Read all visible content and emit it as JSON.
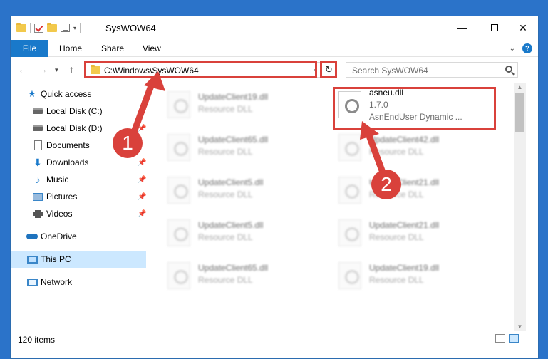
{
  "window": {
    "title": "SysWOW64"
  },
  "ribbon": {
    "tabs": [
      "File",
      "Home",
      "Share",
      "View"
    ]
  },
  "address": {
    "path": "C:\\Windows\\SysWOW64"
  },
  "search": {
    "placeholder": "Search SysWOW64"
  },
  "sidebar": {
    "items": [
      {
        "label": "Quick access",
        "icon": "star-icon"
      },
      {
        "label": "Local Disk (C:)",
        "icon": "drive-icon"
      },
      {
        "label": "Local Disk (D:)",
        "icon": "drive-icon"
      },
      {
        "label": "Documents",
        "icon": "documents-icon"
      },
      {
        "label": "Downloads",
        "icon": "downloads-icon"
      },
      {
        "label": "Music",
        "icon": "music-icon"
      },
      {
        "label": "Pictures",
        "icon": "pictures-icon"
      },
      {
        "label": "Videos",
        "icon": "videos-icon"
      },
      {
        "label": "OneDrive",
        "icon": "cloud-icon"
      },
      {
        "label": "This PC",
        "icon": "computer-icon"
      },
      {
        "label": "Network",
        "icon": "network-icon"
      }
    ]
  },
  "files": {
    "left": [
      {
        "name": "UpdateClient19.dll",
        "type": "Resource DLL"
      },
      {
        "name": "UpdateClient65.dll",
        "type": "Resource DLL"
      },
      {
        "name": "UpdateClient5.dll",
        "type": "Resource DLL"
      },
      {
        "name": "UpdateClient5.dll",
        "type": "Resource DLL"
      },
      {
        "name": "UpdateClient65.dll",
        "type": "Resource DLL"
      }
    ],
    "right": [
      {
        "name": "UpdateClient42.dll",
        "type": "Resource DLL"
      },
      {
        "name": "UpdateClient21.dll",
        "type": "Resource DLL"
      },
      {
        "name": "UpdateClient21.dll",
        "type": "Resource DLL"
      },
      {
        "name": "UpdateClient19.dll",
        "type": "Resource DLL"
      }
    ],
    "focus": {
      "name": "asneu.dll",
      "version": "1.7.0",
      "description": "AsnEndUser Dynamic ..."
    }
  },
  "status": {
    "items": "120 items"
  },
  "callouts": {
    "one": "1",
    "two": "2"
  },
  "colors": {
    "accent": "#1979ca",
    "highlight": "#d9413b",
    "selected": "#cce8ff"
  }
}
